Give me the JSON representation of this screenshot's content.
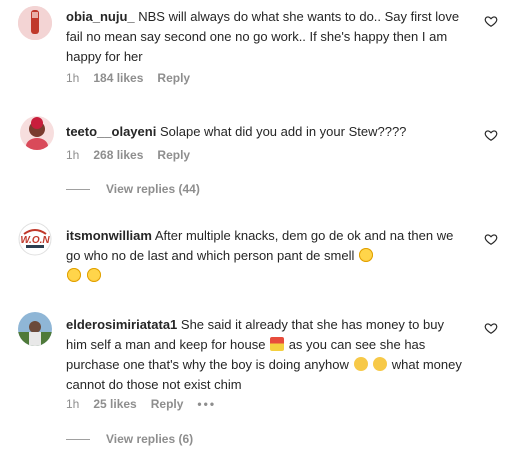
{
  "comments": [
    {
      "username": "obia_nuju_",
      "text": "NBS will always do what she wants to do.. Say first love fail no mean say second one no go work.. If she's happy then I am happy for her",
      "time": "1h",
      "likes": "184 likes",
      "reply": "Reply"
    },
    {
      "username": "teeto__olayeni",
      "text": "Solape what did you add in your Stew????",
      "time": "1h",
      "likes": "268 likes",
      "reply": "Reply",
      "view_replies": "View replies (44)"
    },
    {
      "username": "itsmonwilliam",
      "text": "After multiple knacks, dem go de ok and na then we go who no de last and which person pant de smell",
      "time": "",
      "likes": "",
      "reply": ""
    },
    {
      "username": "elderosimiriatata1",
      "text_part1": "She said it already that she has money to buy him self a man and keep for house",
      "text_part2": "as you can see she has purchase one that's why the boy is doing anyhow",
      "text_part3": "what money cannot do those not exist chim",
      "time": "1h",
      "likes": "25 likes",
      "reply": "Reply",
      "more": "•••",
      "view_replies": "View replies (6)"
    }
  ],
  "avatar3_logo_text": "W.O.N",
  "icons": {
    "heart": "heart-outline-icon",
    "laugh": "laughing-tears-emoji",
    "house": "house-emoji",
    "clap": "clapping-hands-emoji"
  }
}
